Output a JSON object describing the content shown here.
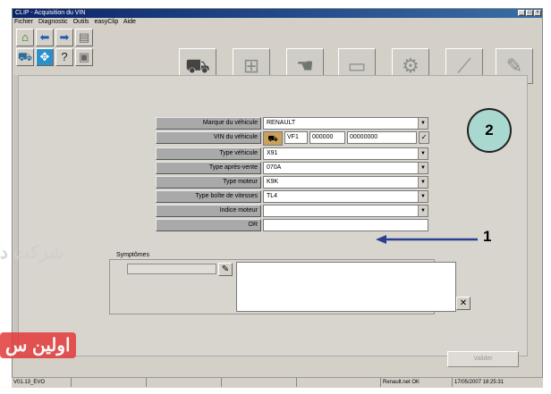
{
  "window": {
    "title": "CLIP - Acquisition du VIN",
    "controls": [
      "_",
      "□",
      "×"
    ]
  },
  "menu": [
    "Fichier",
    "Diagnostic",
    "Outils",
    "easyClip",
    "Aide"
  ],
  "toolbar": {
    "small_icons": [
      "home-icon",
      "back-arrow-icon",
      "forward-arrow-icon",
      "pages-icon",
      "vehicle-link-icon",
      "network-icon",
      "help-icon",
      "car-icon"
    ],
    "big_icons": [
      "vehicle-identification-icon",
      "ecu-icon",
      "hand-icon",
      "fault-screen-icon",
      "injection-icon",
      "measure-icon",
      "repair-tools-icon"
    ]
  },
  "form": {
    "fields": [
      {
        "label": "Marque du véhicule",
        "value": "RENAULT"
      },
      {
        "label": "VIN du véhicule",
        "value": ""
      },
      {
        "label": "Type véhicule",
        "value": "X91"
      },
      {
        "label": "Type après-vente",
        "value": "070A"
      },
      {
        "label": "Type moteur",
        "value": "K9K"
      },
      {
        "label": "Type boîte de vitesses",
        "value": "TL4"
      },
      {
        "label": "Indice moteur",
        "value": ""
      },
      {
        "label": "OR",
        "value": ""
      }
    ],
    "vin_parts": [
      "VF1",
      "000000",
      "00000000"
    ]
  },
  "symptoms": {
    "label": "Symptômes",
    "input_value": "",
    "text": ""
  },
  "action_button": "Valider",
  "status_bar": [
    "V01.13_EVO",
    "",
    "",
    "",
    "",
    "Renault.net OK",
    "17/05/2007 18:25:31"
  ],
  "callouts": {
    "circle": "2",
    "arrow": "1"
  },
  "watermark": {
    "text_fa": "شرکت د",
    "text_fa2": "اولین س"
  },
  "colors": {
    "title_start": "#0a246a",
    "title_end": "#3a6ea5",
    "callout_fill": "#a8d8cf",
    "arrow_blue": "#2b3f8f",
    "watermark_red": "#e23b3b"
  }
}
